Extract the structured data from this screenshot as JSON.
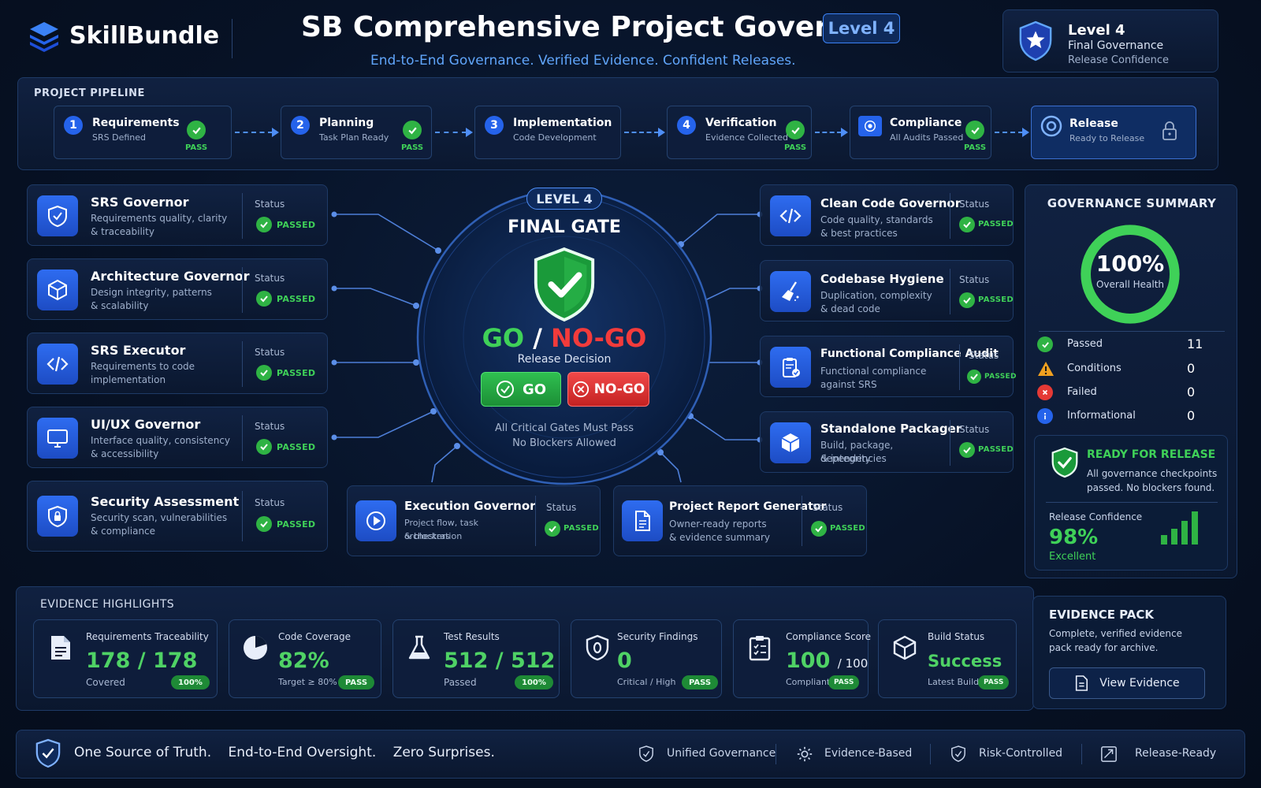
{
  "header": {
    "brand": "SkillBundle",
    "title": "SB Comprehensive Project Governor",
    "level_badge": "Level 4",
    "subtitle": "End-to-End Governance. Verified Evidence. Confident Releases.",
    "badge_card": {
      "line1": "Level 4",
      "line2": "Final Governance",
      "line3": "Release Confidence"
    }
  },
  "pipeline": {
    "title": "PROJECT PIPELINE",
    "steps": [
      {
        "num": "1",
        "title": "Requirements",
        "sub": "SRS Defined",
        "status": "PASS"
      },
      {
        "num": "2",
        "title": "Planning",
        "sub": "Task Plan Ready",
        "status": "PASS"
      },
      {
        "num": "3",
        "title": "Implementation",
        "sub": "Code Development",
        "status": ""
      },
      {
        "num": "4",
        "title": "Verification",
        "sub": "Evidence Collected",
        "status": "PASS"
      },
      {
        "title": "Compliance",
        "sub": "All Audits Passed",
        "status": "PASS"
      },
      {
        "title": "Release",
        "sub": "Ready to Release",
        "status": ""
      }
    ]
  },
  "governors_left": [
    {
      "title": "SRS Governor",
      "desc1": "Requirements quality, clarity",
      "desc2": "& traceability",
      "status_label": "Status",
      "status": "PASSED",
      "icon": "shield-check-icon"
    },
    {
      "title": "Architecture Governor",
      "desc1": "Design integrity, patterns",
      "desc2": "& scalability",
      "status_label": "Status",
      "status": "PASSED",
      "icon": "cube-icon"
    },
    {
      "title": "SRS Executor",
      "desc1": "Requirements to code",
      "desc2": "implementation",
      "status_label": "Status",
      "status": "PASSED",
      "icon": "code-icon"
    },
    {
      "title": "UI/UX Governor",
      "desc1": "Interface quality, consistency",
      "desc2": "& accessibility",
      "status_label": "Status",
      "status": "PASSED",
      "icon": "monitor-icon"
    },
    {
      "title": "Security Assessment",
      "desc1": "Security scan, vulnerabilities",
      "desc2": "& compliance",
      "status_label": "Status",
      "status": "PASSED",
      "icon": "shield-lock-icon"
    }
  ],
  "governors_right": [
    {
      "title": "Clean Code Governor",
      "desc1": "Code quality, standards",
      "desc2": "& best practices",
      "status_label": "Status",
      "status": "PASSED",
      "icon": "code-icon"
    },
    {
      "title": "Codebase Hygiene",
      "desc1": "Duplication, complexity",
      "desc2": "& dead code",
      "status_label": "Status",
      "status": "PASSED",
      "icon": "broom-icon"
    },
    {
      "title": "Functional Compliance Audit",
      "desc1": "Functional compliance",
      "desc2": "against SRS",
      "status_label": "Status",
      "status": "PASSED",
      "icon": "clipboard-check-icon"
    },
    {
      "title": "Standalone Packager",
      "desc1": "Build, package, dependencies",
      "desc2": "& integrity",
      "status_label": "Status",
      "status": "PASSED",
      "icon": "package-icon"
    }
  ],
  "governors_bottom": [
    {
      "title": "Execution Governor",
      "desc1": "Project flow, task orchestration",
      "desc2": "& blockers",
      "status_label": "Status",
      "status": "PASSED",
      "icon": "play-icon"
    },
    {
      "title": "Project Report Generator",
      "desc1": "Owner-ready reports",
      "desc2": "& evidence summary",
      "status_label": "Status",
      "status": "PASSED",
      "icon": "document-icon"
    }
  ],
  "gate": {
    "level": "LEVEL 4",
    "title": "FINAL GATE",
    "go_word": "GO",
    "slash": "/",
    "nogo_word": "NO-GO",
    "decision_label": "Release Decision",
    "go_button": "GO",
    "nogo_button": "NO-GO",
    "note1": "All Critical Gates Must Pass",
    "note2": "No Blockers Allowed"
  },
  "summary": {
    "title": "GOVERNANCE SUMMARY",
    "health_value": "100%",
    "health_label": "Overall Health",
    "health_fraction": 1.0,
    "rows": [
      {
        "label": "Passed",
        "count": "11"
      },
      {
        "label": "Conditions",
        "count": "0"
      },
      {
        "label": "Failed",
        "count": "0"
      },
      {
        "label": "Informational",
        "count": "0"
      }
    ],
    "ready_title": "READY FOR RELEASE",
    "ready_desc1": "All governance checkpoints",
    "ready_desc2": "passed. No blockers found.",
    "confidence_label": "Release Confidence",
    "confidence_value": "98%",
    "confidence_rating": "Excellent"
  },
  "evidence": {
    "title": "EVIDENCE HIGHLIGHTS",
    "cards": [
      {
        "label": "Requirements Traceability",
        "value": "178 / 178",
        "sub": "Covered",
        "badge": "100%",
        "icon": "document-icon"
      },
      {
        "label": "Code Coverage",
        "value": "82%",
        "sub": "Target ≥ 80%",
        "badge": "PASS",
        "icon": "pie-chart-icon"
      },
      {
        "label": "Test Results",
        "value": "512 / 512",
        "sub": "Passed",
        "badge": "100%",
        "icon": "flask-icon"
      },
      {
        "label": "Security Findings",
        "value": "0",
        "sub": "Critical / High",
        "badge": "PASS",
        "icon": "shield-icon"
      },
      {
        "label": "Compliance Score",
        "value": "100",
        "value_suffix": "/ 100",
        "sub": "Compliant",
        "badge": "PASS",
        "icon": "clipboard-icon"
      },
      {
        "label": "Build Status",
        "value": "Success",
        "sub": "Latest Build",
        "badge": "PASS",
        "icon": "box-icon"
      }
    ],
    "pack_title": "EVIDENCE PACK",
    "pack_desc1": "Complete, verified evidence",
    "pack_desc2": "pack ready for archive.",
    "pack_button": "View Evidence"
  },
  "footer": {
    "tagline1": "One Source of Truth.",
    "tagline2": "End-to-End Oversight.",
    "tagline3": "Zero Surprises.",
    "items": [
      "Unified Governance",
      "Evidence-Based",
      "Risk-Controlled",
      "Release-Ready"
    ]
  },
  "colors": {
    "accent": "#2563eb",
    "pass": "#2fb344",
    "fail": "#e53935",
    "background": "#071226"
  }
}
